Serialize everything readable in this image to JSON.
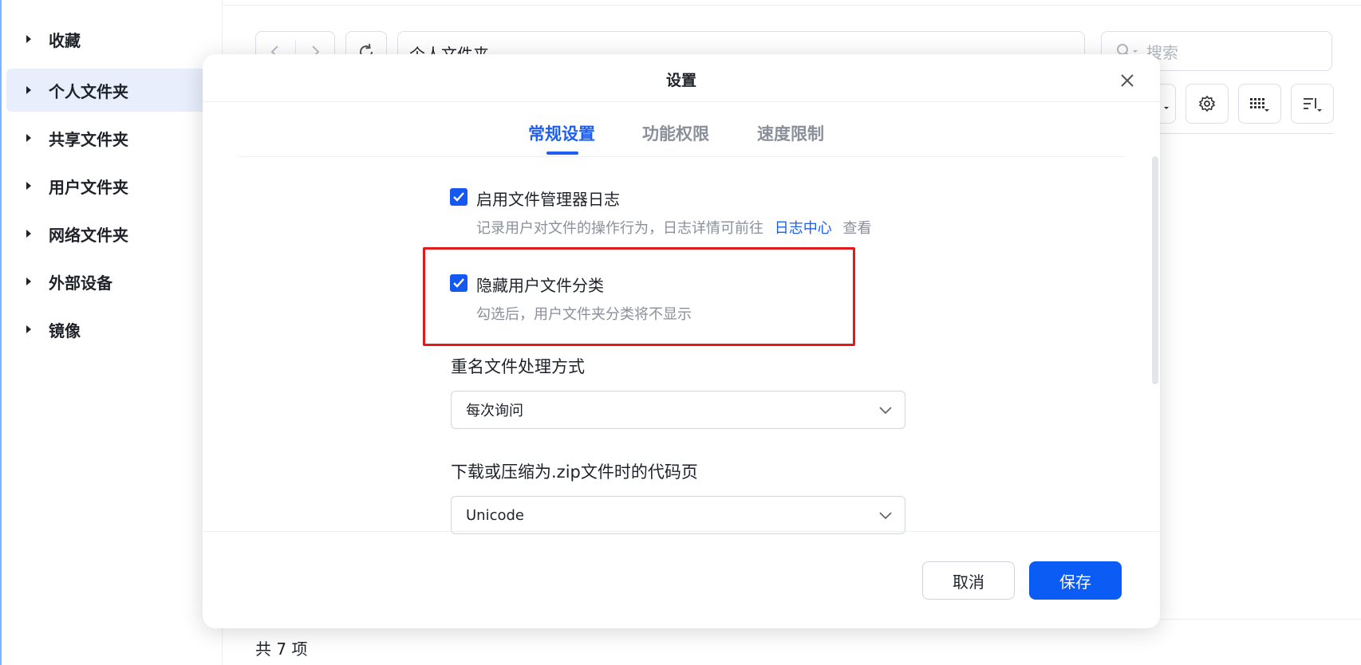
{
  "sidebar": {
    "items": [
      {
        "label": "收藏"
      },
      {
        "label": "个人文件夹"
      },
      {
        "label": "共享文件夹"
      },
      {
        "label": "用户文件夹"
      },
      {
        "label": "网络文件夹"
      },
      {
        "label": "外部设备"
      },
      {
        "label": "镜像"
      }
    ],
    "active_index": 1
  },
  "toolbar": {
    "path": "个人文件夹",
    "search_placeholder": "搜索"
  },
  "status": {
    "count_text": "共 7 项"
  },
  "dialog": {
    "title": "设置",
    "tabs": [
      {
        "label": "常规设置",
        "active": true
      },
      {
        "label": "功能权限",
        "active": false
      },
      {
        "label": "速度限制",
        "active": false
      }
    ],
    "options": [
      {
        "checked": true,
        "title": "启用文件管理器日志",
        "desc_prefix": "记录用户对文件的操作行为，日志详情可前往",
        "desc_link": "日志中心",
        "desc_suffix": "查看"
      },
      {
        "checked": true,
        "title": "隐藏用户文件分类",
        "desc": "勾选后，用户文件夹分类将不显示"
      }
    ],
    "rename_label": "重名文件处理方式",
    "rename_value": "每次询问",
    "codepage_label": "下载或压缩为.zip文件时的代码页",
    "codepage_value": "Unicode",
    "cancel_label": "取消",
    "save_label": "保存"
  },
  "colors": {
    "accent": "#1e5ef0",
    "highlight": "#e11a1a",
    "primary_button": "#0b5cf5"
  }
}
